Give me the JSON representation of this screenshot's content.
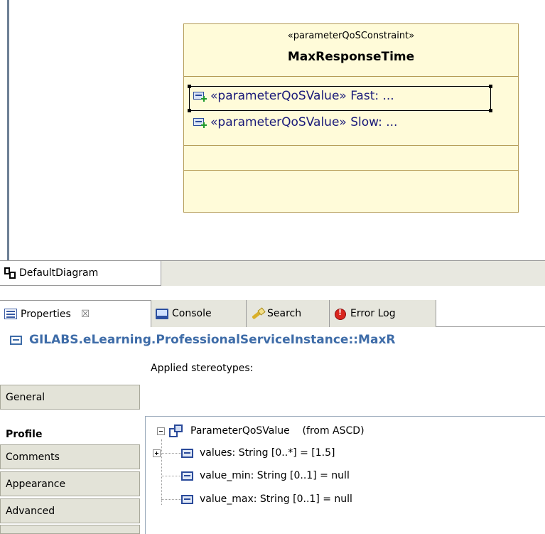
{
  "diagram": {
    "element": {
      "stereotype": "«parameterQoSConstraint»",
      "name": "MaxResponseTime",
      "attributes": [
        {
          "text": "«parameterQoSValue»  Fast: ...",
          "icon": "attribute-add-icon",
          "selected": true
        },
        {
          "text": "«parameterQoSValue»  Slow: ...",
          "icon": "attribute-add-icon",
          "selected": false
        }
      ]
    },
    "tab_label": "DefaultDiagram"
  },
  "views": {
    "tabs": [
      {
        "label": "Properties",
        "icon": "properties-icon",
        "active": true,
        "closable": true
      },
      {
        "label": "Console",
        "icon": "console-icon",
        "active": false
      },
      {
        "label": "Search",
        "icon": "search-icon",
        "active": false
      },
      {
        "label": "Error Log",
        "icon": "error-log-icon",
        "active": false
      }
    ],
    "close_glyph": "☒"
  },
  "properties": {
    "element_title": "GILABS.eLearning.ProfessionalServiceInstance::MaxR",
    "side_tabs": [
      "General",
      "Profile",
      "Comments",
      "Appearance",
      "Advanced"
    ],
    "active_side_tab": "Profile",
    "applied_label": "Applied stereotypes:",
    "tree": {
      "root": "ParameterQoSValue    (from ASCD)",
      "children": [
        "values: String [0..*] = [1.5]",
        "value_min: String [0..1] = null",
        "value_max: String [0..1] = null"
      ]
    }
  },
  "colors": {
    "class_fill": "#fffbd9",
    "class_border": "#b59b55",
    "title_blue": "#3e6ca8",
    "attr_text": "#1a1a7a"
  }
}
